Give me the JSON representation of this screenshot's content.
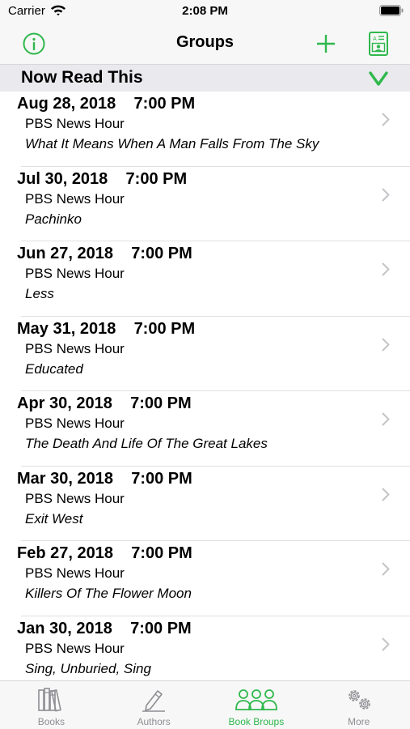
{
  "status_bar": {
    "carrier": "Carrier",
    "time": "2:08 PM"
  },
  "nav": {
    "title": "Groups",
    "info_icon": "info-icon",
    "add_icon": "plus-icon",
    "contact_icon": "contact-card-icon"
  },
  "section": {
    "title": "Now Read This",
    "icon": "chevron-down-icon"
  },
  "rows": [
    {
      "date": "Aug 28, 2018",
      "time": "7:00 PM",
      "show": "PBS News Hour",
      "book": "What It Means When A Man Falls From The Sky"
    },
    {
      "date": "Jul 30, 2018",
      "time": "7:00 PM",
      "show": "PBS News Hour",
      "book": "Pachinko"
    },
    {
      "date": "Jun 27, 2018",
      "time": "7:00 PM",
      "show": "PBS News Hour",
      "book": "Less"
    },
    {
      "date": "May 31, 2018",
      "time": "7:00 PM",
      "show": "PBS News Hour",
      "book": "Educated"
    },
    {
      "date": "Apr 30, 2018",
      "time": "7:00 PM",
      "show": "PBS News Hour",
      "book": "The Death And Life Of The Great Lakes"
    },
    {
      "date": "Mar 30, 2018",
      "time": "7:00 PM",
      "show": "PBS News Hour",
      "book": "Exit West"
    },
    {
      "date": "Feb 27, 2018",
      "time": "7:00 PM",
      "show": "PBS News Hour",
      "book": "Killers Of The Flower Moon"
    },
    {
      "date": "Jan 30, 2018",
      "time": "7:00 PM",
      "show": "PBS News Hour",
      "book": "Sing, Unburied, Sing"
    }
  ],
  "tabs": [
    {
      "label": "Books",
      "icon": "books-icon",
      "active": false
    },
    {
      "label": "Authors",
      "icon": "pencil-icon",
      "active": false
    },
    {
      "label": "Book Broups",
      "icon": "groups-icon",
      "active": true
    },
    {
      "label": "More",
      "icon": "gears-icon",
      "active": false
    }
  ],
  "colors": {
    "accent": "#2fb84c",
    "inactive": "#8e8e93",
    "section_bg": "#e9e9ee",
    "bar_bg": "#f7f7f7"
  }
}
